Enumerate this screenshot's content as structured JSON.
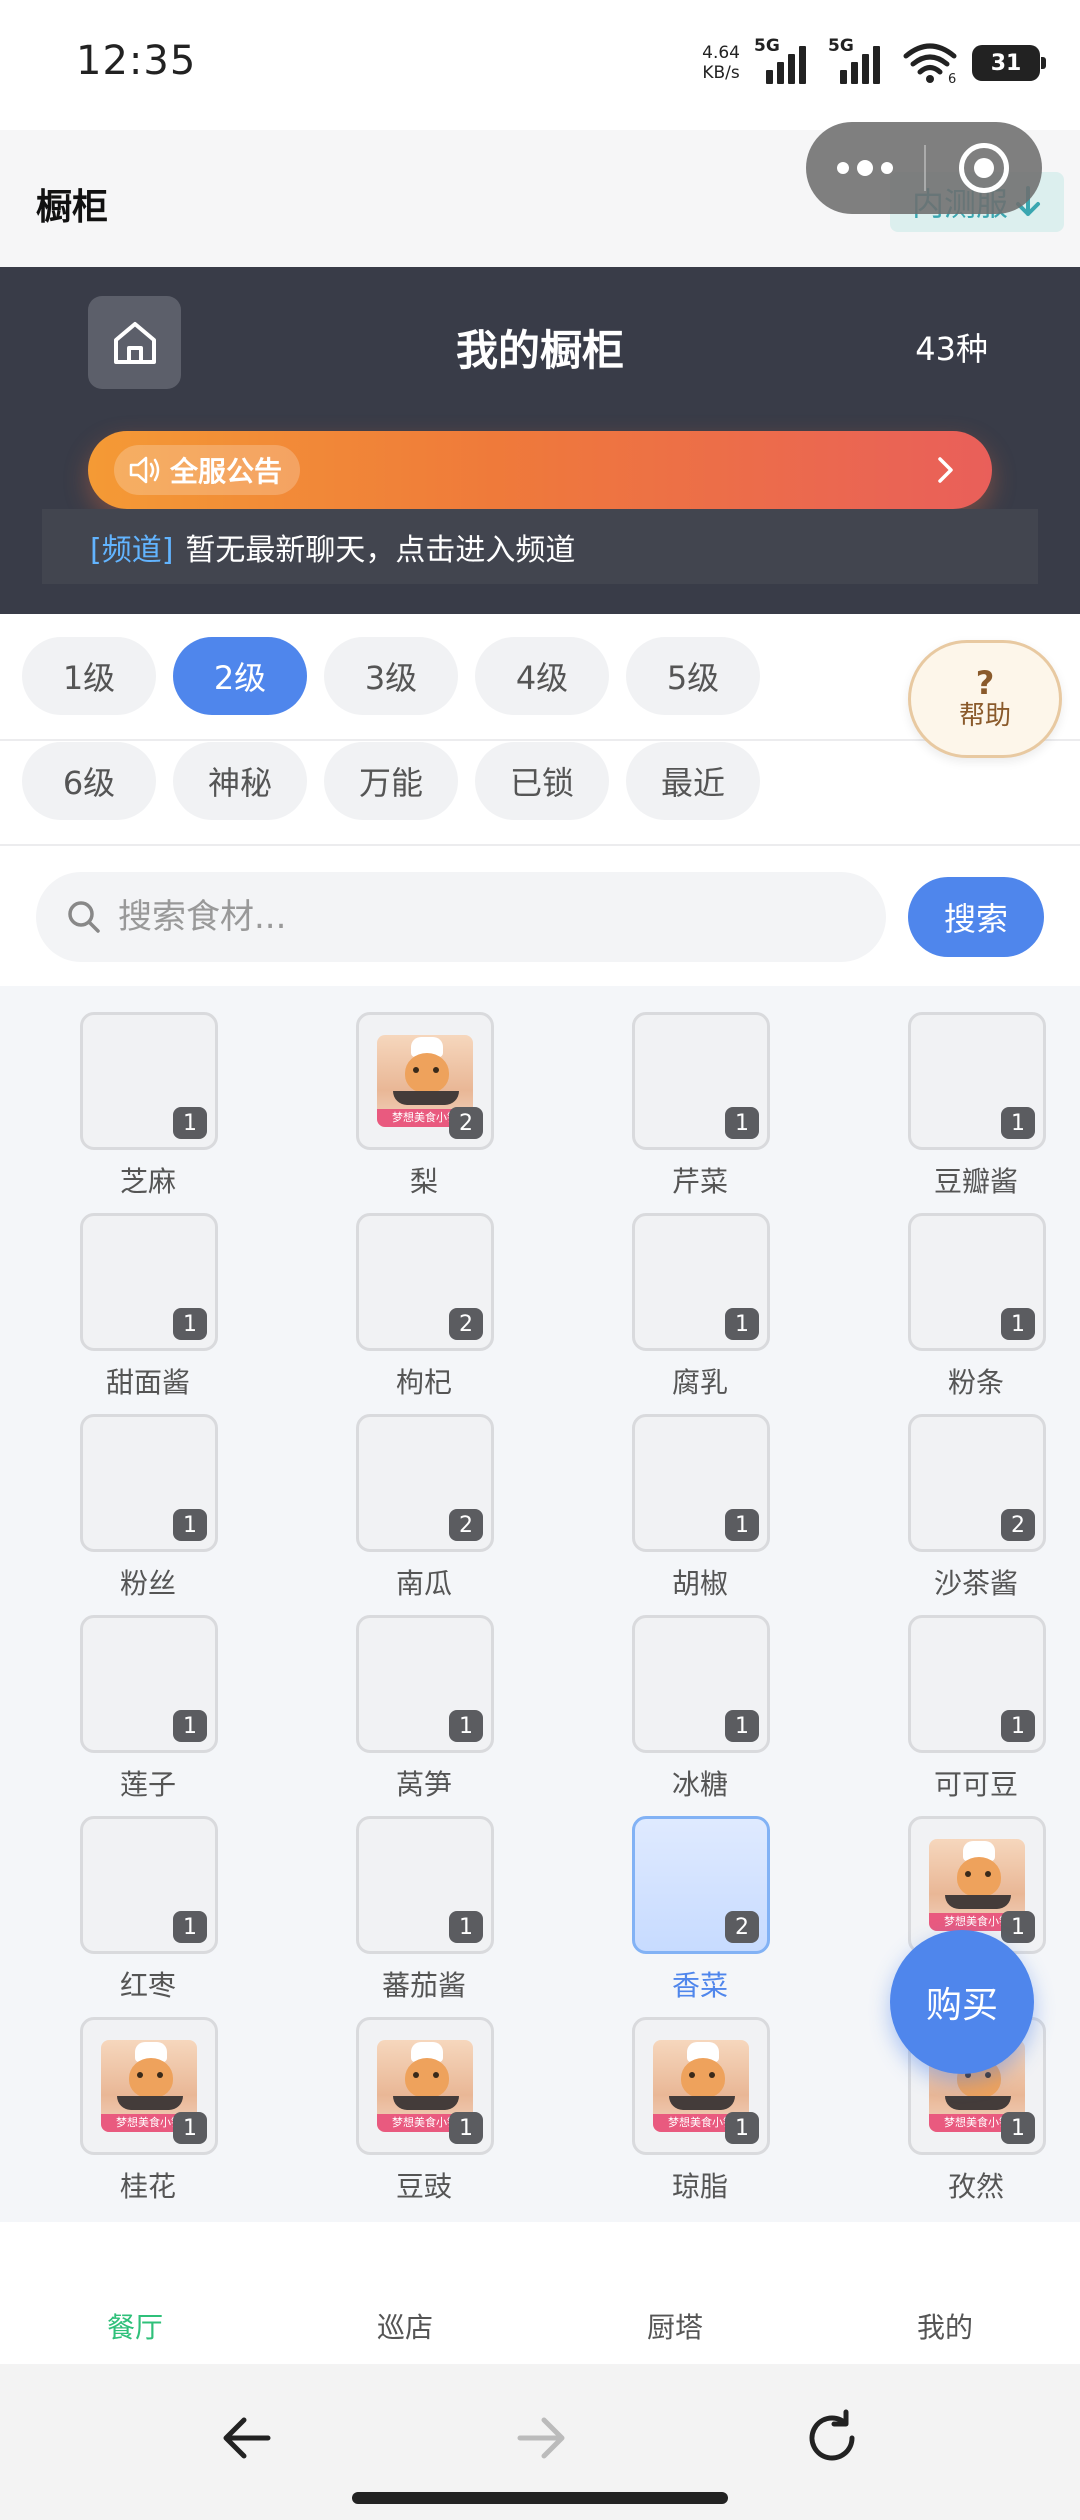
{
  "status": {
    "time": "12:35",
    "net_speed_value": "4.64",
    "net_speed_unit": "KB/s",
    "sim1": "5G",
    "sim2": "5G",
    "wifi_level": "6",
    "battery": "31"
  },
  "header": {
    "title": "橱柜",
    "beta_tag": "内测服"
  },
  "banner": {
    "title": "我的橱柜",
    "count": "43种",
    "notice_tag": "全服公告",
    "channel_tag": "[频道]",
    "channel_text": "暂无最新聊天，点击进入频道"
  },
  "levels": {
    "row1": [
      "1级",
      "2级",
      "3级",
      "4级",
      "5级"
    ],
    "row2": [
      "6级",
      "神秘",
      "万能",
      "已锁",
      "最近"
    ],
    "active": "2级"
  },
  "help": {
    "mark": "?",
    "label": "帮助"
  },
  "search": {
    "placeholder": "搜索食材...",
    "button": "搜索"
  },
  "ingredients": [
    {
      "name": "芝麻",
      "count": "1",
      "image": false
    },
    {
      "name": "梨",
      "count": "2",
      "image": true
    },
    {
      "name": "芹菜",
      "count": "1",
      "image": false
    },
    {
      "name": "豆瓣酱",
      "count": "1",
      "image": false
    },
    {
      "name": "甜面酱",
      "count": "1",
      "image": false
    },
    {
      "name": "枸杞",
      "count": "2",
      "image": false
    },
    {
      "name": "腐乳",
      "count": "1",
      "image": false
    },
    {
      "name": "粉条",
      "count": "1",
      "image": false
    },
    {
      "name": "粉丝",
      "count": "1",
      "image": false
    },
    {
      "name": "南瓜",
      "count": "2",
      "image": false
    },
    {
      "name": "胡椒",
      "count": "1",
      "image": false
    },
    {
      "name": "沙茶酱",
      "count": "2",
      "image": false
    },
    {
      "name": "莲子",
      "count": "1",
      "image": false
    },
    {
      "name": "莴笋",
      "count": "1",
      "image": false
    },
    {
      "name": "冰糖",
      "count": "1",
      "image": false
    },
    {
      "name": "可可豆",
      "count": "1",
      "image": false
    },
    {
      "name": "红枣",
      "count": "1",
      "image": false
    },
    {
      "name": "蕃茄酱",
      "count": "1",
      "image": false
    },
    {
      "name": "香菜",
      "count": "2",
      "image": false,
      "selected": true
    },
    {
      "name": "",
      "count": "1",
      "image": true
    },
    {
      "name": "桂花",
      "count": "1",
      "image": true
    },
    {
      "name": "豆豉",
      "count": "1",
      "image": true
    },
    {
      "name": "琼脂",
      "count": "1",
      "image": true
    },
    {
      "name": "孜然",
      "count": "1",
      "image": true
    }
  ],
  "thumb_caption": "梦想美食小镇",
  "buy_button": "购买",
  "tabs": [
    "餐厅",
    "巡店",
    "厨塔",
    "我的"
  ],
  "active_tab": "餐厅",
  "colors": {
    "accent": "#4f86ec",
    "tab_active": "#2fc07a",
    "banner_bg": "#393c48"
  }
}
